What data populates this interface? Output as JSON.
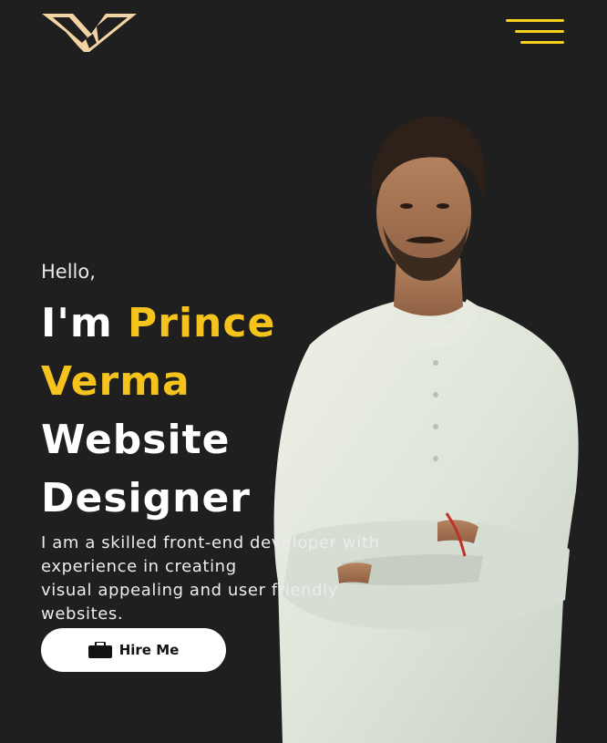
{
  "header": {
    "logo_icon": "stylized-v-logo-icon",
    "menu_icon": "hamburger-menu-icon"
  },
  "hero": {
    "greeting": "Hello,",
    "intro": "I'm",
    "first_name": "Prince",
    "last_name": "Verma",
    "role_line1": "Website",
    "role_line2": "Designer",
    "bio_lines": [
      "I am a skilled front-end developer with",
      "experience in creating",
      "visual appealing and user friendly",
      "websites."
    ],
    "cta_label": "Hire Me",
    "cta_icon": "briefcase-icon"
  },
  "colors": {
    "background": "#1f1f1f",
    "accent": "#f6c21c",
    "menu": "#f6d21c",
    "logo": "#f3d3a4",
    "text": "#ffffff"
  }
}
